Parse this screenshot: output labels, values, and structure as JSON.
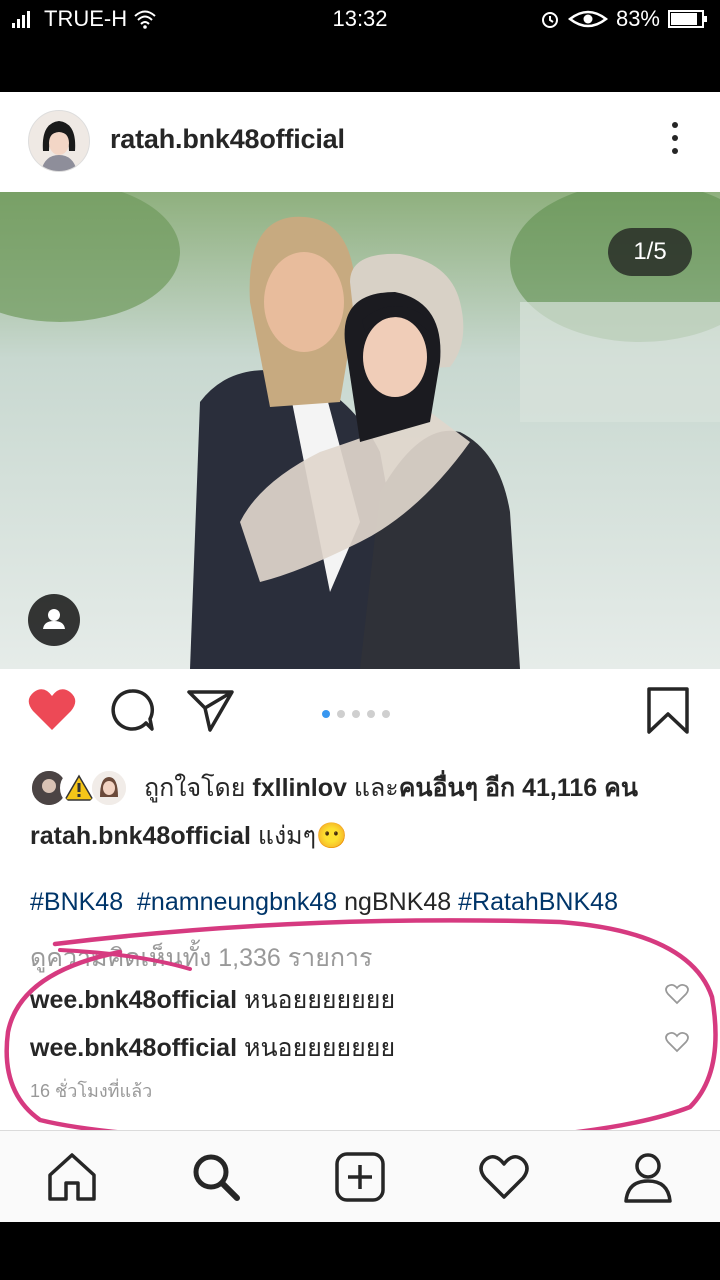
{
  "status_bar": {
    "carrier": "TRUE-H",
    "time": "13:32",
    "battery": "83%"
  },
  "post": {
    "username": "ratah.bnk48official",
    "photo_counter": "1/5",
    "carousel": {
      "count": 5,
      "active": 1
    },
    "likes": {
      "prefix": "ถูกใจโดย",
      "user": "fxllinlov",
      "middle": "และ",
      "others": "คนอื่นๆ อีก 41,116 คน"
    },
    "caption": {
      "user": "ratah.bnk48official",
      "text": "แง่มๆ",
      "emoji": "😶"
    },
    "hashtags": [
      "#BNK48",
      "#namneungbnk48"
    ],
    "hashtag_plain": "ngBNK48",
    "hashtag_last": "#RatahBNK48",
    "view_all_comments": "ดูความคิดเห็นทั้ง 1,336 รายการ",
    "comments": [
      {
        "user": "wee.bnk48official",
        "text": "หนอยยยยยยย"
      },
      {
        "user": "wee.bnk48official",
        "text": "หนอยยยยยยย"
      }
    ],
    "time_ago": "16 ชั่วโมงที่แล้ว"
  },
  "colors": {
    "like_red": "#ed4956",
    "link_blue": "#003569",
    "annotation": "#d63a80",
    "dot_active": "#3897f0"
  },
  "icons": [
    "signal-icon",
    "wifi-icon",
    "alarm-icon",
    "eye-icon",
    "battery-icon",
    "more-options-icon",
    "heart-filled-icon",
    "comment-icon",
    "share-icon",
    "bookmark-icon",
    "user-tag-icon",
    "home-icon",
    "search-icon",
    "add-post-icon",
    "activity-heart-icon",
    "profile-icon"
  ]
}
